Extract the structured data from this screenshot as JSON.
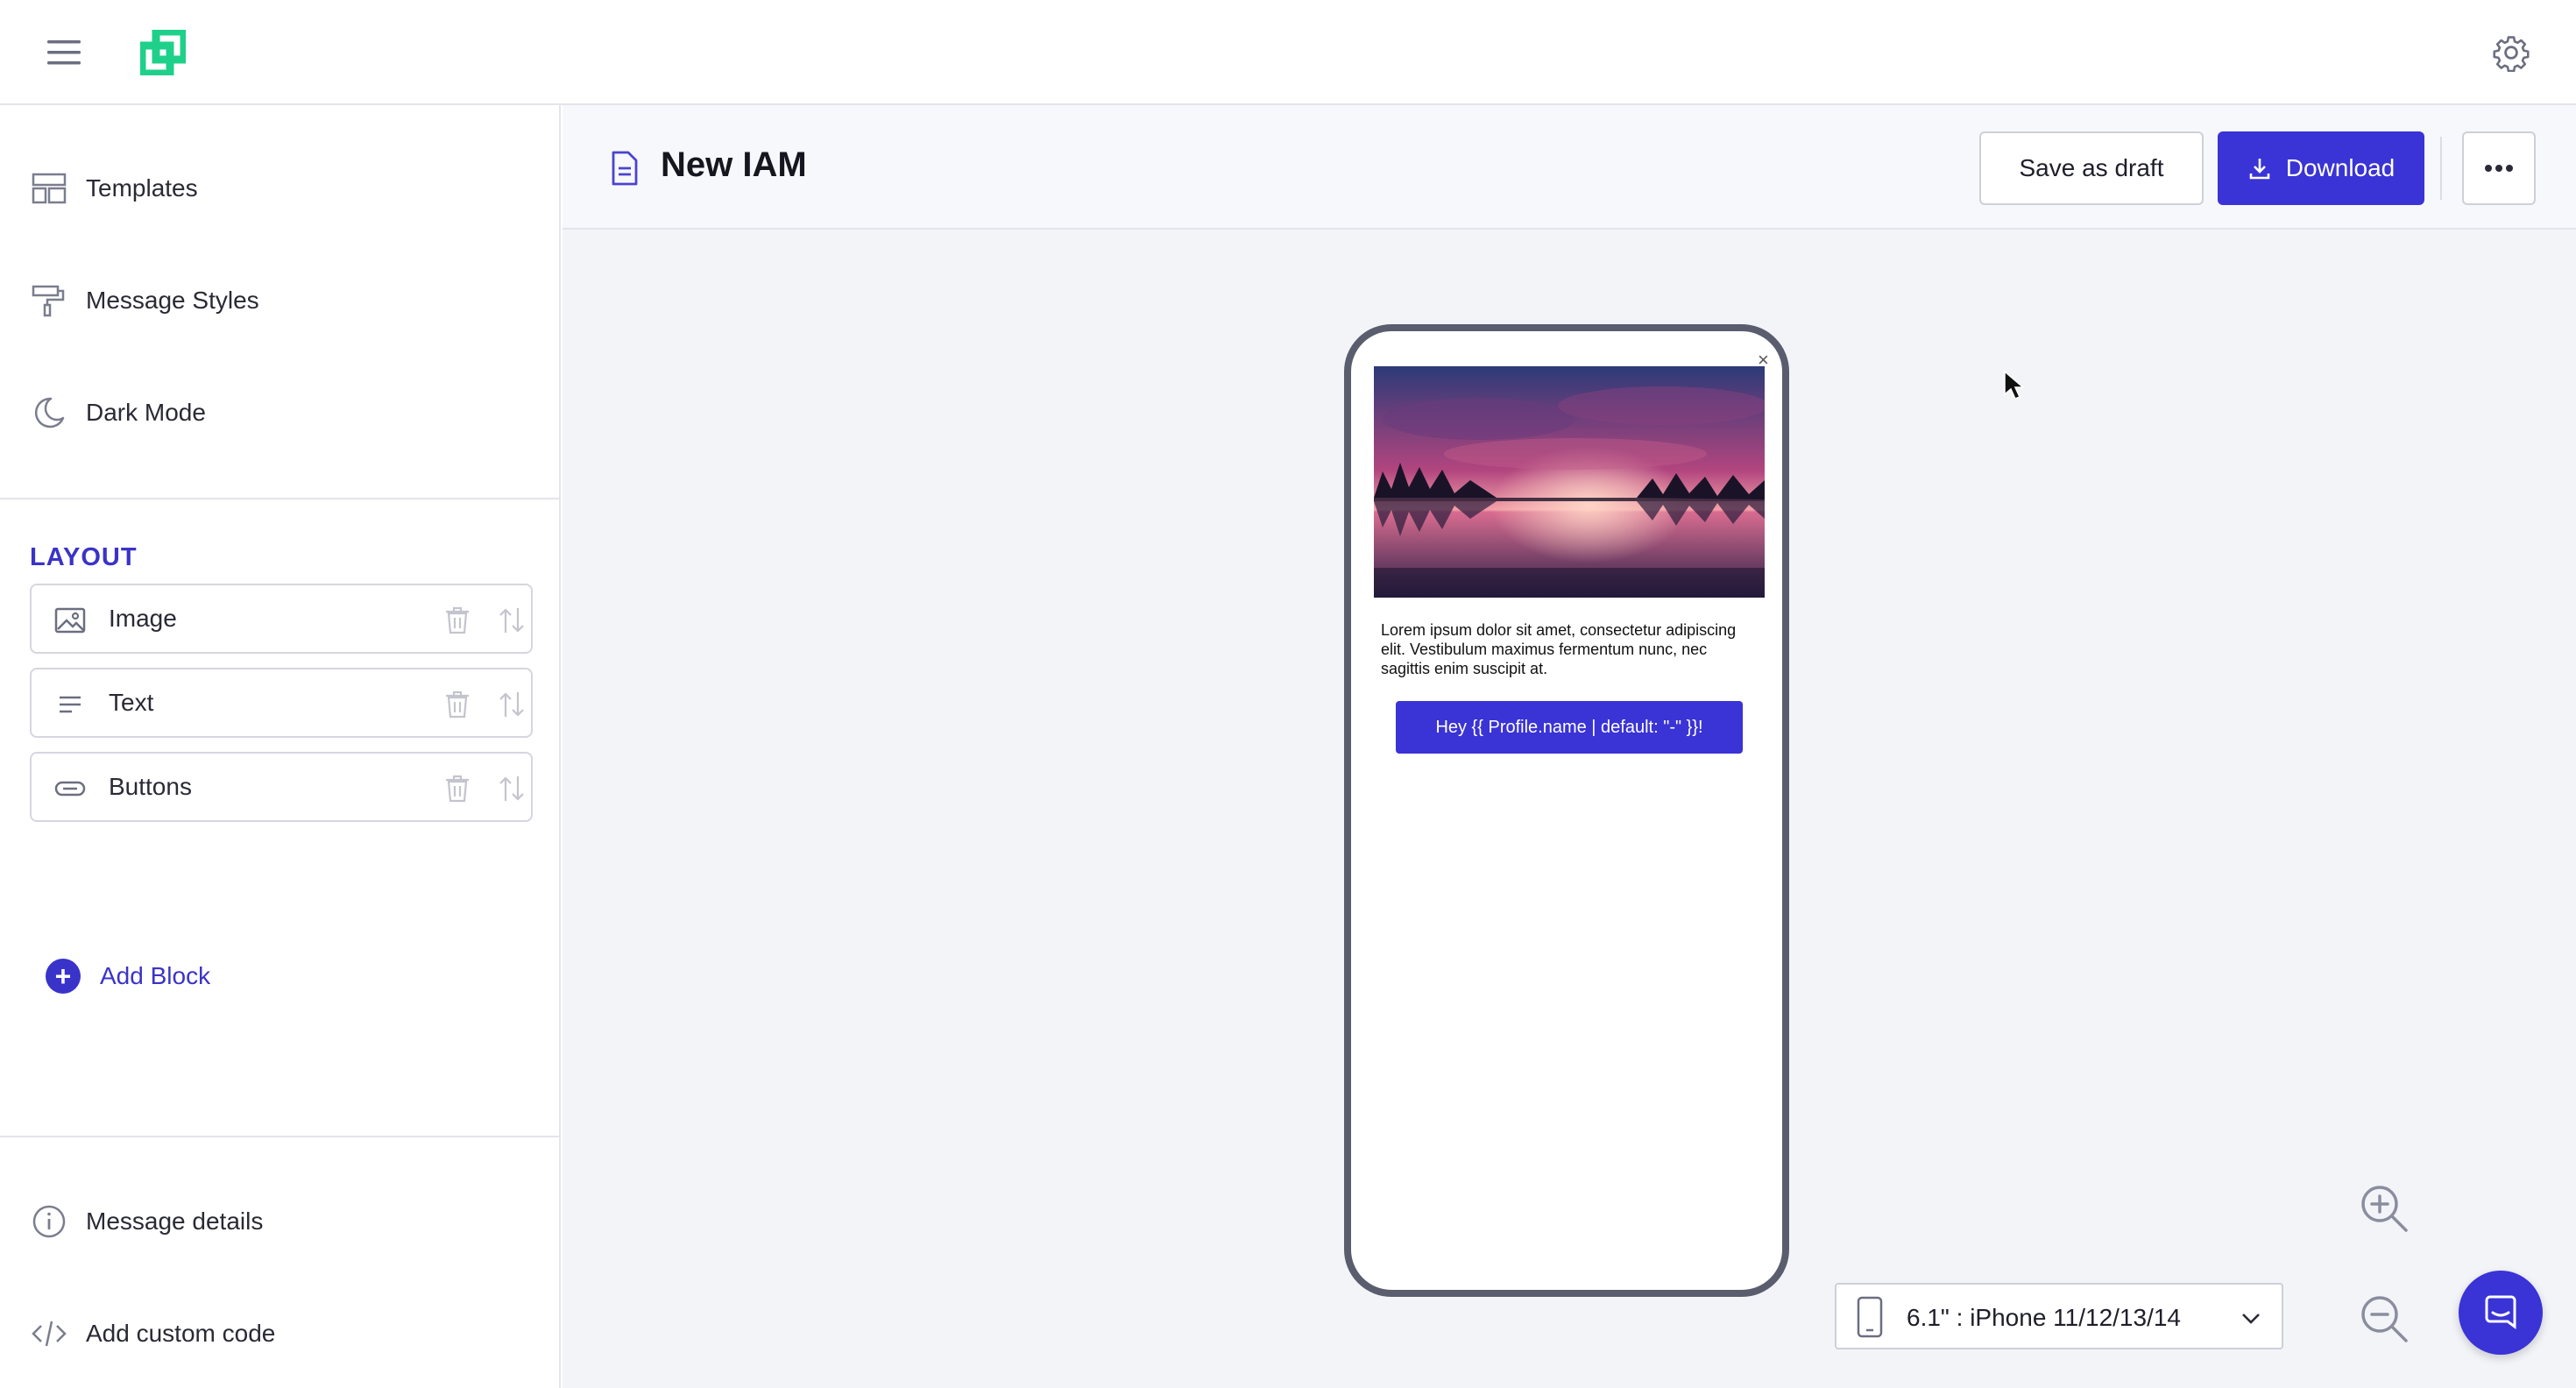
{
  "app": {
    "logo": "logo-icon"
  },
  "sidebar": {
    "nav": [
      {
        "label": "Templates",
        "icon": "templates-icon"
      },
      {
        "label": "Message Styles",
        "icon": "paint-roller-icon"
      },
      {
        "label": "Dark Mode",
        "icon": "moon-icon"
      }
    ],
    "layout_title": "LAYOUT",
    "blocks": [
      {
        "label": "Image",
        "icon": "image-icon"
      },
      {
        "label": "Text",
        "icon": "text-lines-icon"
      },
      {
        "label": "Buttons",
        "icon": "button-pill-icon"
      }
    ],
    "add_block": "Add Block",
    "bottom": [
      {
        "label": "Message details",
        "icon": "info-icon"
      },
      {
        "label": "Add custom code",
        "icon": "code-icon"
      }
    ]
  },
  "header": {
    "title": "New IAM",
    "save_draft": "Save as draft",
    "download": "Download"
  },
  "preview": {
    "close": "×",
    "body_text": "Lorem ipsum dolor sit amet, consectetur adipiscing elit. Vestibulum maximus fermentum nunc, nec sagittis enim suscipit at.",
    "button_label": "Hey {{ Profile.name | default: \"-\" }}!",
    "device": "6.1\" : iPhone 11/12/13/14"
  },
  "colors": {
    "accent": "#3a33d6",
    "brand_green": "#1fd08a",
    "background": "#f3f4f8"
  }
}
